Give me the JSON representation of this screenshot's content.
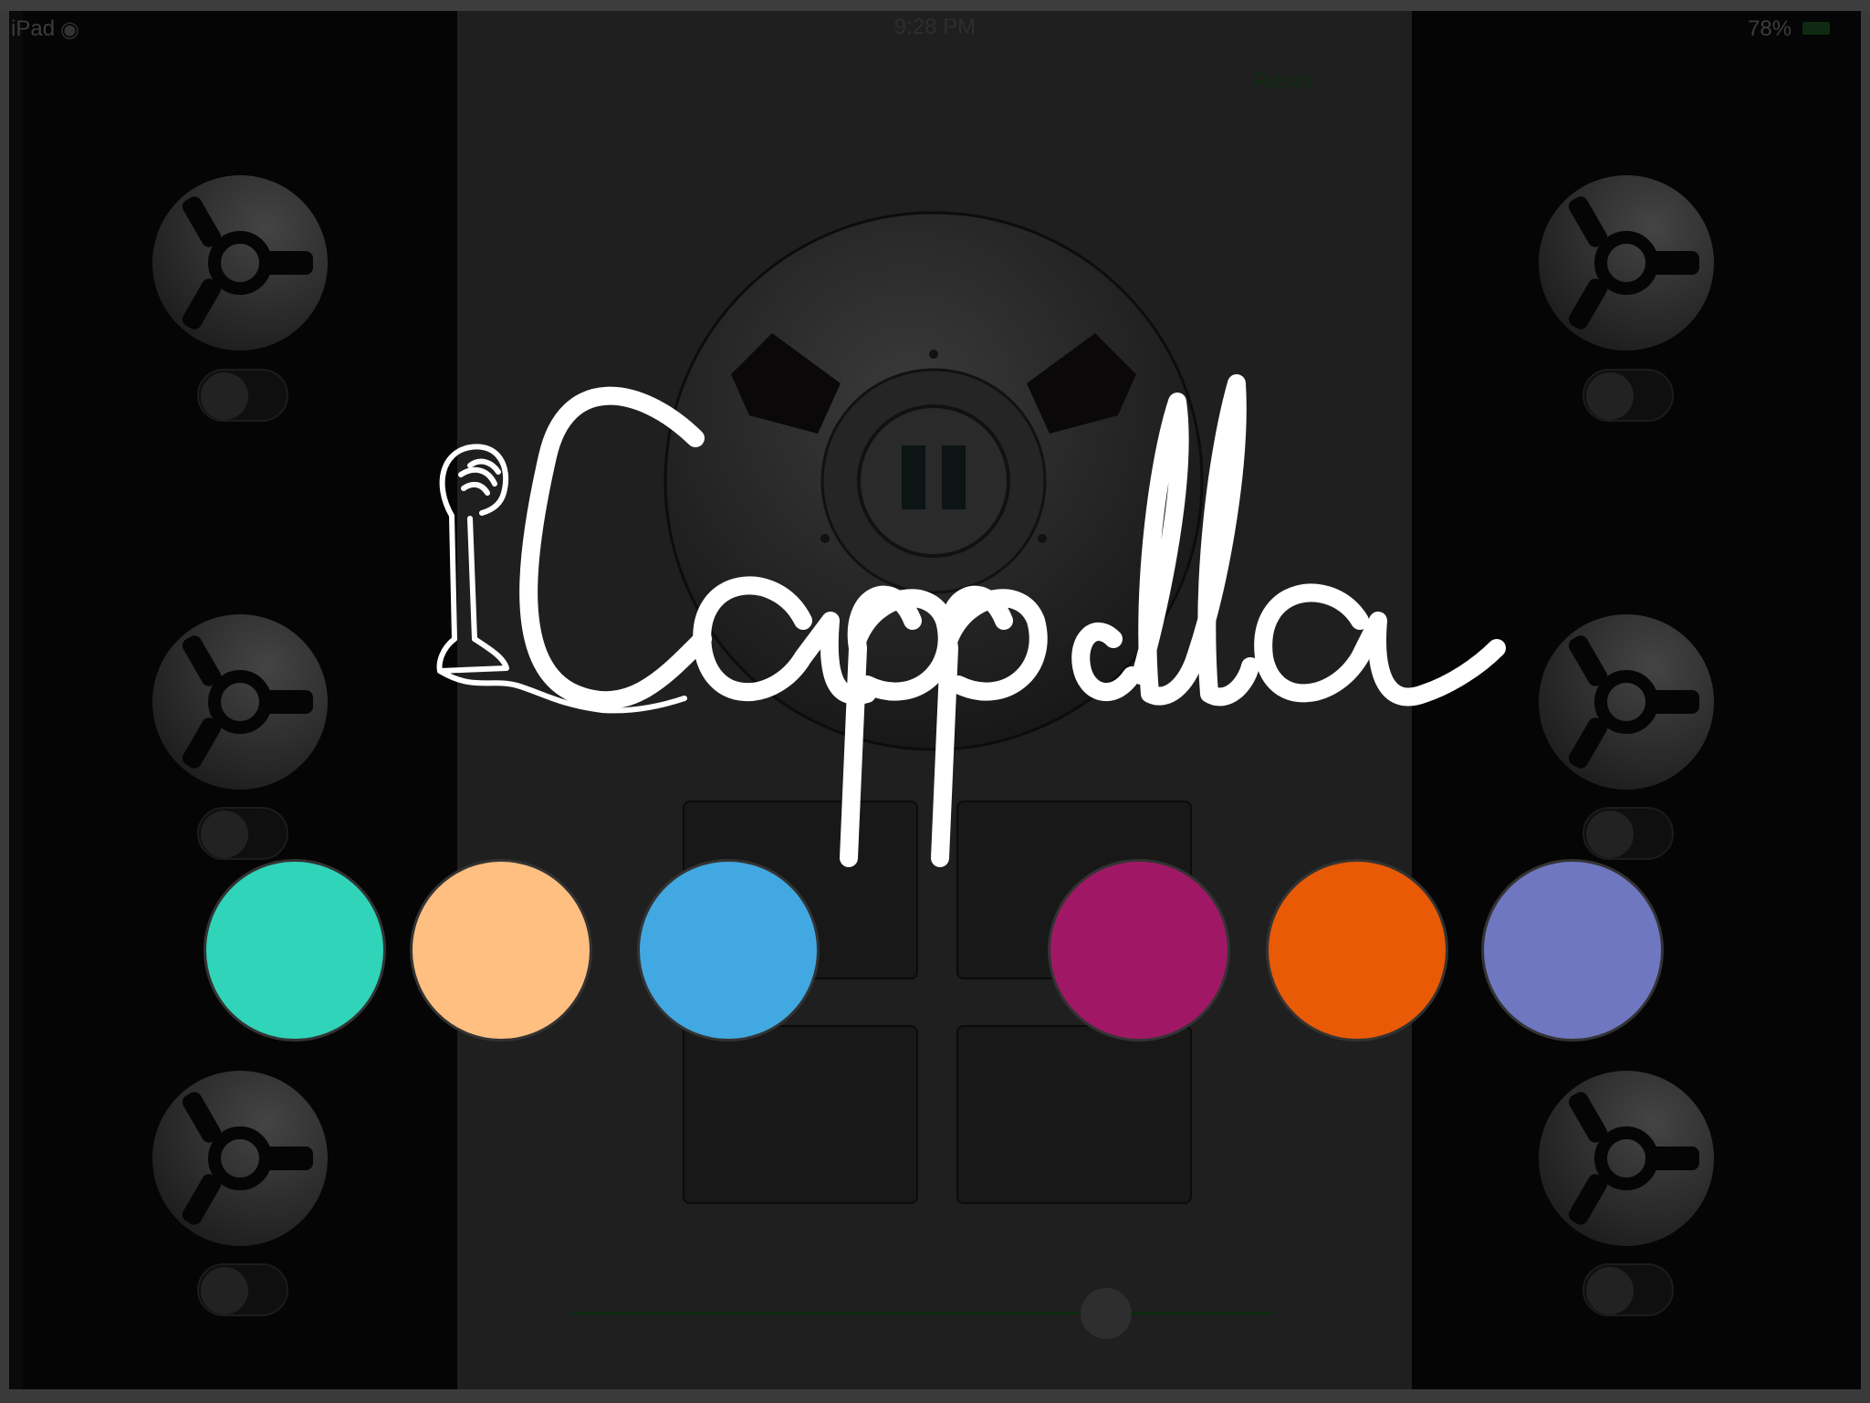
{
  "status_bar": {
    "device": "iPad",
    "time": "9:28 PM",
    "battery_percent": "78%"
  },
  "header": {
    "reset_label": "Reset"
  },
  "logo": {
    "alt": "iCappella"
  },
  "tracks": {
    "left": [
      {
        "toggle_on": false
      },
      {
        "toggle_on": false
      },
      {
        "toggle_on": false
      }
    ],
    "right": [
      {
        "toggle_on": false
      },
      {
        "toggle_on": false
      },
      {
        "toggle_on": false
      }
    ]
  },
  "main_reel": {
    "state": "pause-icon"
  },
  "pads_count": 4,
  "slider": {
    "value_fraction": 0.76
  },
  "color_swatches": [
    {
      "color": "#2fd4b9"
    },
    {
      "color": "#ffbf80"
    },
    {
      "color": "#42a8e2"
    },
    {
      "color": "#a01865"
    },
    {
      "color": "#e85a05"
    },
    {
      "color": "#6e77c0"
    }
  ]
}
